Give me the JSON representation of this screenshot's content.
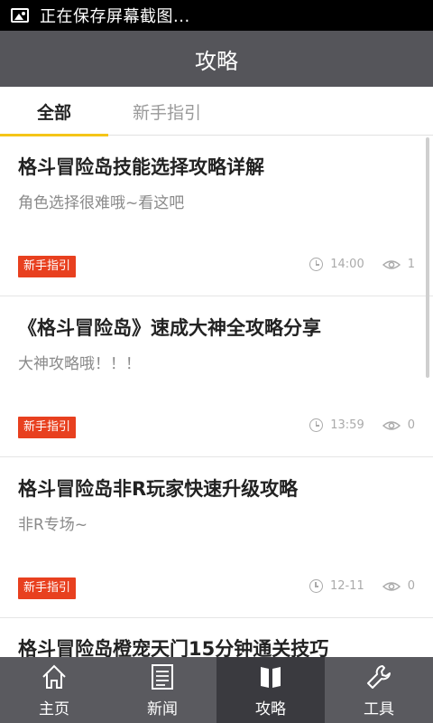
{
  "status": {
    "text": "正在保存屏幕截图..."
  },
  "header": {
    "title": "攻略"
  },
  "tabs": [
    {
      "label": "全部",
      "active": true
    },
    {
      "label": "新手指引",
      "active": false
    }
  ],
  "articles": [
    {
      "title": "格斗冒险岛技能选择攻略详解",
      "desc": "角色选择很难哦~看这吧",
      "tag": "新手指引",
      "time": "14:00",
      "views": "1"
    },
    {
      "title": "《格斗冒险岛》速成大神全攻略分享",
      "desc": "大神攻略哦！！！",
      "tag": "新手指引",
      "time": "13:59",
      "views": "0"
    },
    {
      "title": "格斗冒险岛非R玩家快速升级攻略",
      "desc": "非R专场~",
      "tag": "新手指引",
      "time": "12-11",
      "views": "0"
    },
    {
      "title": "格斗冒险岛橙宠天门15分钟通关技巧"
    }
  ],
  "nav": [
    {
      "label": "主页",
      "icon": "home-icon"
    },
    {
      "label": "新闻",
      "icon": "news-icon"
    },
    {
      "label": "攻略",
      "icon": "book-icon",
      "active": true
    },
    {
      "label": "工具",
      "icon": "wrench-icon"
    }
  ],
  "colors": {
    "accent": "#f5c518",
    "tag": "#e8401f",
    "titlebar": "#55555a",
    "nav": "#5a5a5f",
    "nav_active": "#3a3a3f"
  }
}
